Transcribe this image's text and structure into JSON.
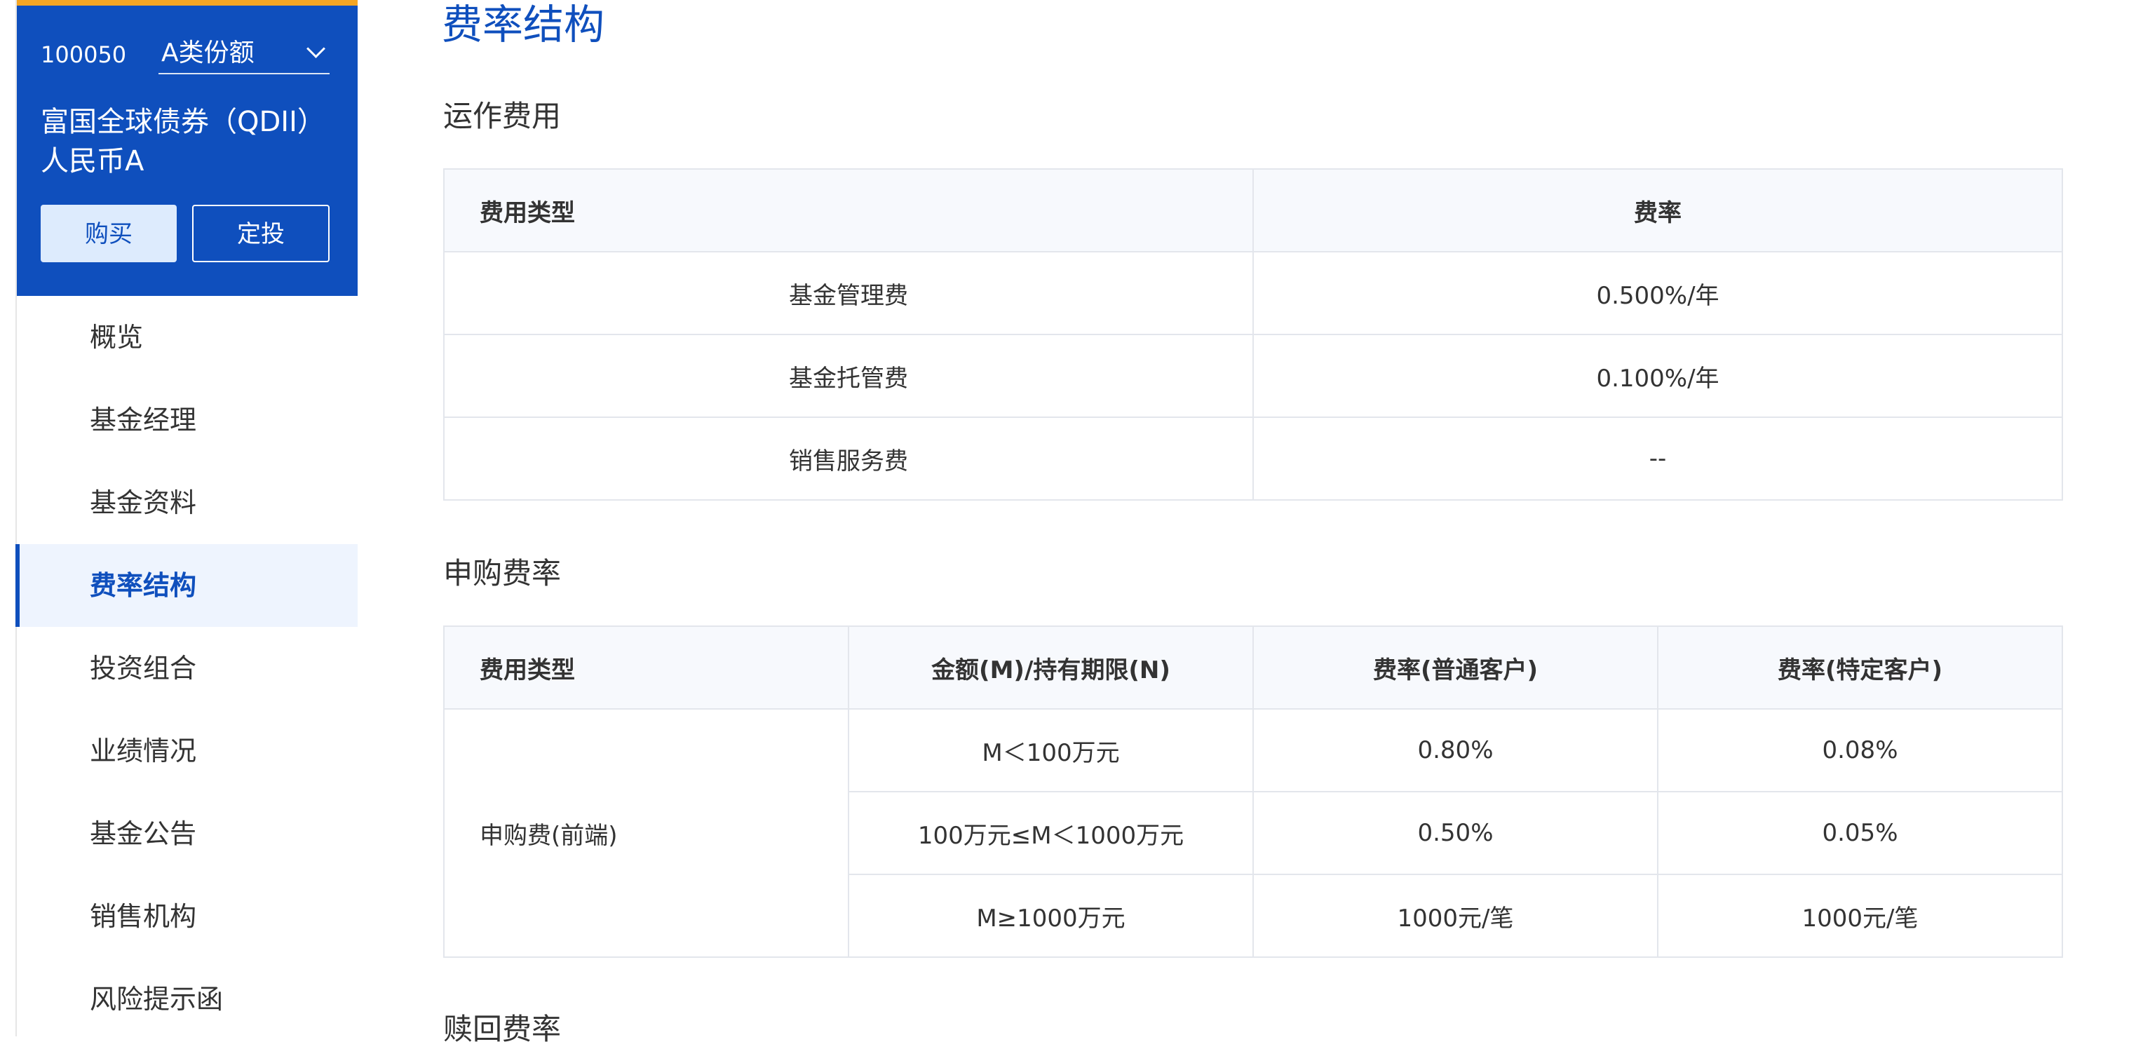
{
  "fund": {
    "code": "100050",
    "share_class": "A类份额",
    "name": "富国全球债券（QDII）人民币A",
    "buy_label": "购买",
    "plan_label": "定投",
    "colors": {
      "card_bg": "#0f4fbd",
      "accent_bar": "#f5a623"
    }
  },
  "nav": {
    "items": [
      {
        "label": "概览"
      },
      {
        "label": "基金经理"
      },
      {
        "label": "基金资料"
      },
      {
        "label": "费率结构",
        "active": true
      },
      {
        "label": "投资组合"
      },
      {
        "label": "业绩情况"
      },
      {
        "label": "基金公告"
      },
      {
        "label": "销售机构"
      },
      {
        "label": "风险提示函"
      }
    ]
  },
  "main": {
    "title": "费率结构",
    "operation": {
      "title": "运作费用",
      "headers": [
        "费用类型",
        "费率"
      ],
      "rows": [
        [
          "基金管理费",
          "0.500%/年"
        ],
        [
          "基金托管费",
          "0.100%/年"
        ],
        [
          "销售服务费",
          "--"
        ]
      ]
    },
    "subscription": {
      "title": "申购费率",
      "headers": [
        "费用类型",
        "金额(M)/持有期限(N)",
        "费率(普通客户)",
        "费率(特定客户)"
      ],
      "fee_type": "申购费(前端)",
      "rows": [
        [
          "M＜100万元",
          "0.80%",
          "0.08%"
        ],
        [
          "100万元≤M＜1000万元",
          "0.50%",
          "0.05%"
        ],
        [
          "M≥1000万元",
          "1000元/笔",
          "1000元/笔"
        ]
      ]
    },
    "redemption": {
      "title": "赎回费率"
    }
  }
}
